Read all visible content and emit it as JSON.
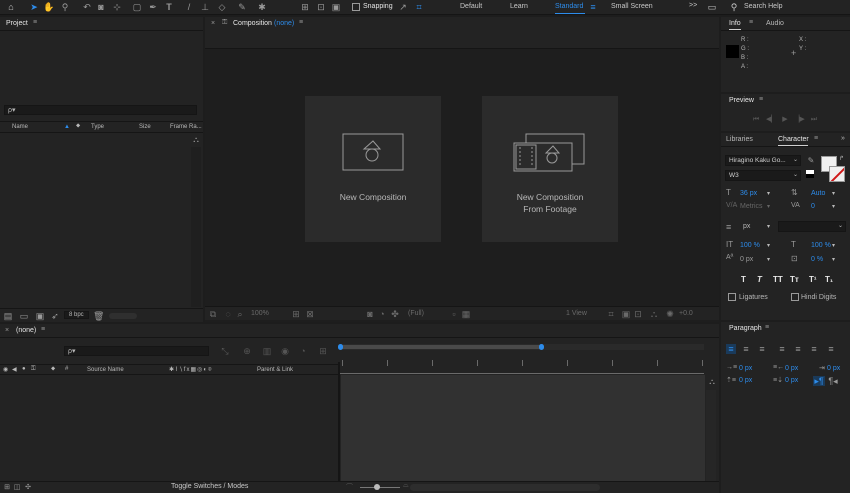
{
  "toolbar": {
    "snapping_label": "Snapping",
    "workspaces": [
      "Default",
      "Learn",
      "Standard",
      "Small Screen"
    ],
    "active_workspace": "Standard",
    "search_placeholder": "Search Help",
    "overflow": ">>"
  },
  "project": {
    "title": "Project",
    "search_placeholder": "ρ▾",
    "columns": [
      "Name",
      "Type",
      "Size",
      "Frame Ra..."
    ],
    "bpc": "8 bpc"
  },
  "composition": {
    "tab_prefix": "Composition",
    "tab_value": "(none)",
    "new_comp_label": "New Composition",
    "new_comp_footage_line1": "New Composition",
    "new_comp_footage_line2": "From Footage",
    "zoom": "100%",
    "resolution": "(Full)",
    "view": "1 View",
    "exposure": "+0.0"
  },
  "info": {
    "tab_info": "Info",
    "tab_audio": "Audio",
    "r": "R :",
    "g": "G :",
    "b": "B :",
    "a": "A :",
    "x": "X :",
    "y": "Y :"
  },
  "preview": {
    "title": "Preview"
  },
  "character": {
    "tab_libraries": "Libraries",
    "tab_character": "Character",
    "font_family": "Hiragino Kaku Go...",
    "font_style": "W3",
    "font_size": "36 px",
    "leading": "Auto",
    "kerning": "Metrics",
    "tracking": "0",
    "stroke_unit": "px",
    "vert_scale": "100 %",
    "horiz_scale": "100 %",
    "baseline": "0 px",
    "tsume": "0 %",
    "style_buttons": [
      "T",
      "T",
      "TT",
      "Tт",
      "T¹",
      "T₁"
    ],
    "ligatures": "Ligatures",
    "hindi_digits": "Hindi Digits"
  },
  "paragraph": {
    "title": "Paragraph",
    "indent_left": "0 px",
    "indent_first": "0 px",
    "space_before": "0 px",
    "space_after": "0 px",
    "indent_right": "0 px"
  },
  "timeline": {
    "tab_label": "(none)",
    "search_placeholder": "ρ▾",
    "col_source": "Source Name",
    "col_parent": "Parent & Link",
    "toggle_label": "Toggle Switches / Modes"
  },
  "colors": {
    "accent": "#2d8ceb",
    "panel": "#232323",
    "frame": "#1d1d1d",
    "card": "#2b2b2b"
  }
}
